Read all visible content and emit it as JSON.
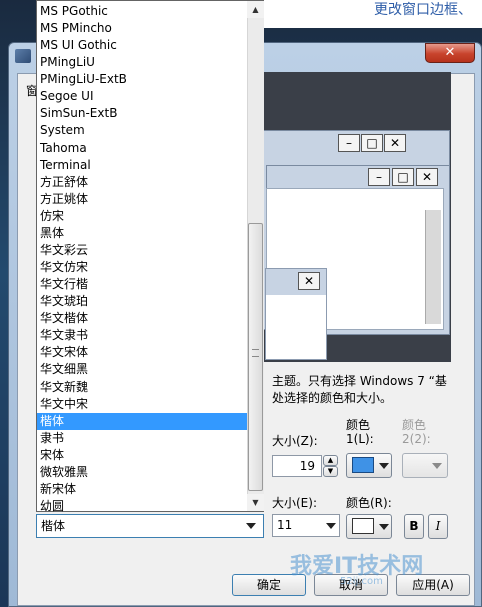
{
  "background": {
    "top_link_text": "更改窗口边框、"
  },
  "dialog": {
    "close_label": "✕",
    "tab_partial": "窗",
    "description_line1": "主题。只有选择 Windows 7 “基",
    "description_line2": "处选择的颜色和大小。",
    "item_size_label": "大小(Z):",
    "color1_label_line1": "颜色",
    "color1_label_line2": "1(L):",
    "color2_label_line1": "颜色",
    "color2_label_line2": "2(2):",
    "item_size_value": "19",
    "font_size_label": "大小(E):",
    "font_color_label": "颜色(R):",
    "font_size_value": "11",
    "bold_label": "B",
    "italic_label": "I",
    "color1_hex": "#3f92e6",
    "font_color_hex": "#ffffff",
    "ok_label": "确定",
    "cancel_label": "取消",
    "apply_label": "应用(A)"
  },
  "font_dropdown": {
    "selected_value": "楷体",
    "items": [
      "MS PGothic",
      "MS PMincho",
      "MS UI Gothic",
      "PMingLiU",
      "PMingLiU-ExtB",
      "Segoe UI",
      "SimSun-ExtB",
      "System",
      "Tahoma",
      "Terminal",
      "方正舒体",
      "方正姚体",
      "仿宋",
      "黑体",
      "华文彩云",
      "华文仿宋",
      "华文行楷",
      "华文琥珀",
      "华文楷体",
      "华文隶书",
      "华文宋体",
      "华文细黑",
      "华文新魏",
      "华文中宋",
      "楷体",
      "隶书",
      "宋体",
      "微软雅黑",
      "新宋体",
      "幼圆"
    ],
    "selected_index": 24
  },
  "watermark": {
    "text": "我爱IT技术网",
    "sub": "52ij.com"
  }
}
